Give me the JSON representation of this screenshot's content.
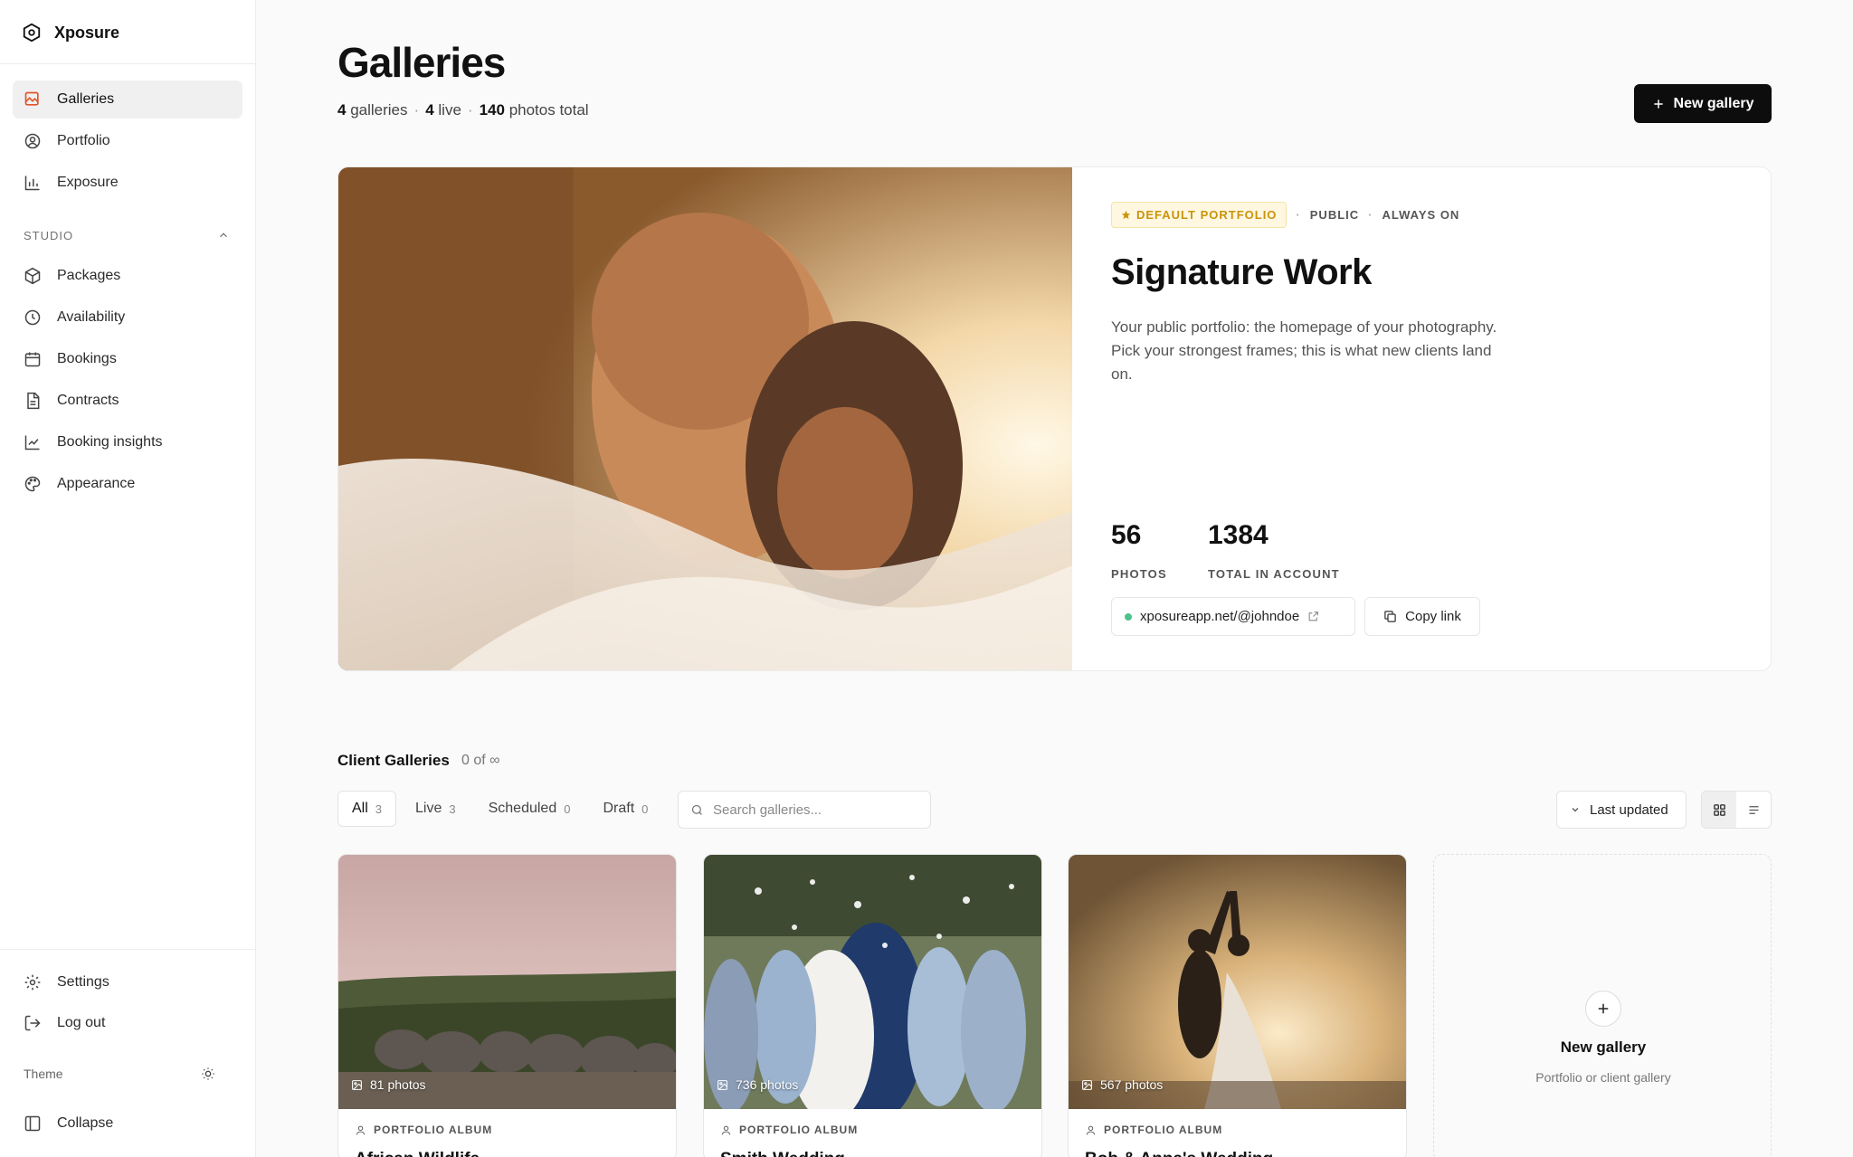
{
  "app": {
    "name": "Xposure"
  },
  "sidebar": {
    "primary": [
      {
        "label": "Galleries",
        "icon": "gallery-icon",
        "active": true
      },
      {
        "label": "Portfolio",
        "icon": "user-circle-icon"
      },
      {
        "label": "Exposure",
        "icon": "bar-chart-icon"
      }
    ],
    "section_label": "STUDIO",
    "studio": [
      {
        "label": "Packages",
        "icon": "package-icon"
      },
      {
        "label": "Availability",
        "icon": "clock-icon"
      },
      {
        "label": "Bookings",
        "icon": "calendar-icon"
      },
      {
        "label": "Contracts",
        "icon": "document-icon"
      },
      {
        "label": "Booking insights",
        "icon": "line-chart-icon"
      },
      {
        "label": "Appearance",
        "icon": "palette-icon"
      }
    ],
    "footer": [
      {
        "label": "Settings",
        "icon": "gear-icon"
      },
      {
        "label": "Log out",
        "icon": "logout-icon"
      }
    ],
    "theme_label": "Theme",
    "collapse_label": "Collapse"
  },
  "header": {
    "title": "Galleries",
    "stats": {
      "galleries_num": "4",
      "galleries_label": "galleries",
      "live_num": "4",
      "live_label": "live",
      "photos_num": "140",
      "photos_label": "photos total"
    },
    "new_button": "New gallery"
  },
  "hero": {
    "badge": "DEFAULT PORTFOLIO",
    "visibility": "PUBLIC",
    "status": "ALWAYS ON",
    "title": "Signature Work",
    "description": "Your public portfolio: the homepage of your photography. Pick your strongest frames; this is what new clients land on.",
    "photos_value": "56",
    "photos_label": "PHOTOS",
    "total_value": "1384",
    "total_label": "TOTAL IN ACCOUNT",
    "url": "xposureapp.net/@johndoe",
    "copy_label": "Copy link"
  },
  "client_galleries": {
    "title": "Client Galleries",
    "count": "0 of ∞",
    "tabs": [
      {
        "label": "All",
        "count": "3",
        "active": true
      },
      {
        "label": "Live",
        "count": "3"
      },
      {
        "label": "Scheduled",
        "count": "0"
      },
      {
        "label": "Draft",
        "count": "0"
      }
    ],
    "search_placeholder": "Search galleries...",
    "sort_label": "Last updated",
    "cards": [
      {
        "photos": "81 photos",
        "type": "PORTFOLIO ALBUM",
        "name": "African Wildlife"
      },
      {
        "photos": "736 photos",
        "type": "PORTFOLIO ALBUM",
        "name": "Smith Wedding"
      },
      {
        "photos": "567 photos",
        "type": "PORTFOLIO ALBUM",
        "name": "Bob & Anna's Wedding"
      }
    ],
    "new_card": {
      "title": "New gallery",
      "subtitle": "Portfolio or client gallery"
    }
  },
  "colors": {
    "accent": "#0d0d0d",
    "badge_text": "#c9940b",
    "badge_bg": "#fff7e0",
    "live_dot": "#4cc38a"
  }
}
